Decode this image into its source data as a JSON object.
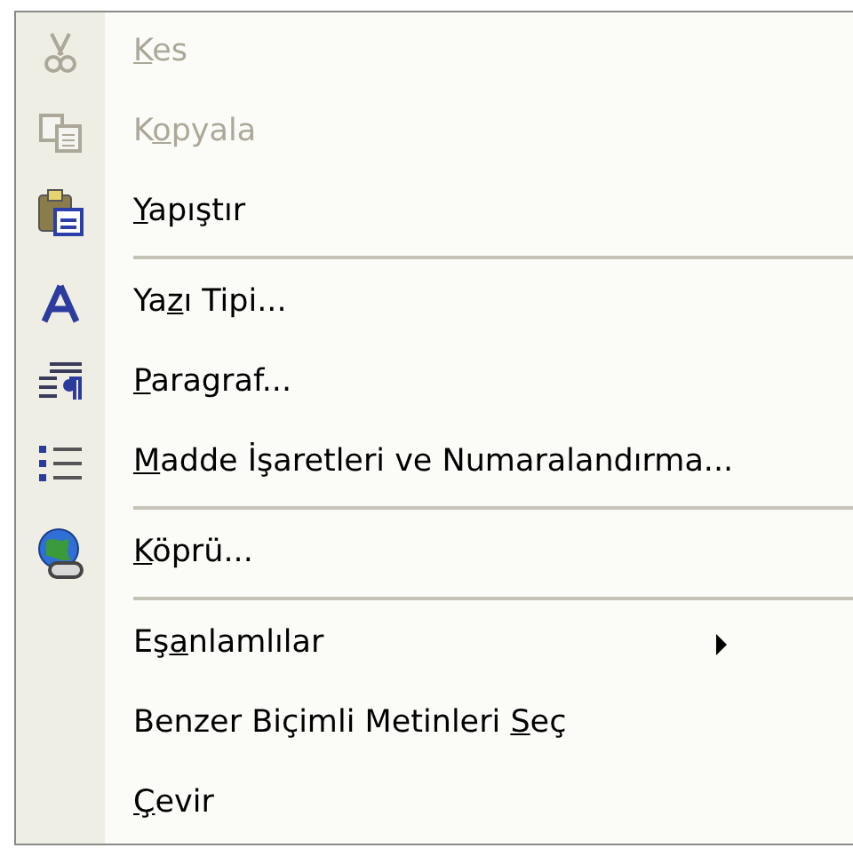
{
  "menu": {
    "items": [
      {
        "kind": "item",
        "label": "Kes",
        "disabled": true
      },
      {
        "kind": "item",
        "label": "Kopyala",
        "disabled": true
      },
      {
        "kind": "item",
        "label": "Yapıştır",
        "disabled": false
      },
      {
        "kind": "separator"
      },
      {
        "kind": "item",
        "label": "Yazı Tipi...",
        "disabled": false
      },
      {
        "kind": "item",
        "label": "Paragraf...",
        "disabled": false
      },
      {
        "kind": "item",
        "label": "Madde İşaretleri ve Numaralandırma...",
        "disabled": false
      },
      {
        "kind": "separator"
      },
      {
        "kind": "item",
        "label": "Köprü...",
        "disabled": false
      },
      {
        "kind": "separator"
      },
      {
        "kind": "submenu",
        "label": "Eşanlamlılar",
        "disabled": false
      },
      {
        "kind": "item",
        "label": "Benzer Biçimli Metinleri Seç",
        "disabled": false
      },
      {
        "kind": "item",
        "label": "Çevir",
        "disabled": false
      }
    ]
  }
}
